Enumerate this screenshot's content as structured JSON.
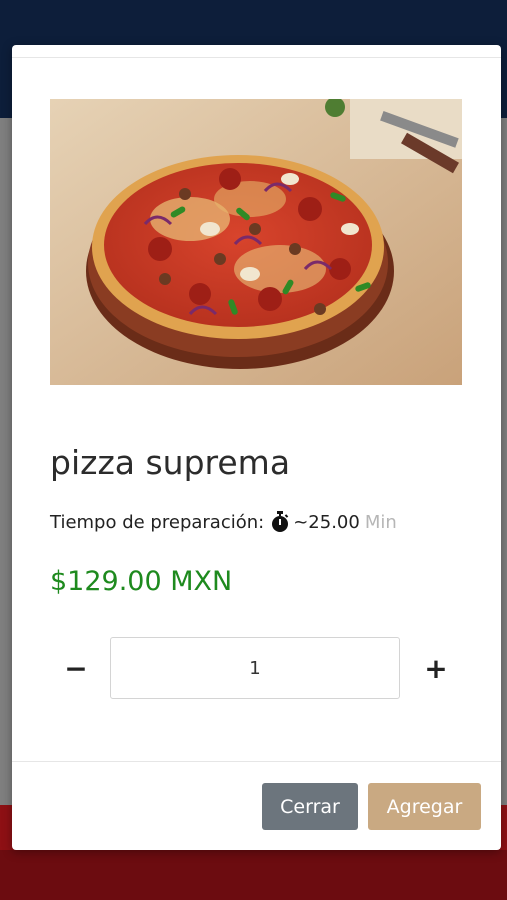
{
  "product": {
    "name": "pizza suprema",
    "prep_label": "Tiempo de preparación:",
    "prep_time": "~25.00",
    "prep_unit": "Min",
    "price": "$129.00 MXN",
    "quantity": "1",
    "image_icon": "pizza-photo"
  },
  "controls": {
    "minus": "−",
    "plus": "+"
  },
  "footer": {
    "close_label": "Cerrar",
    "add_label": "Agregar"
  },
  "colors": {
    "price": "#1e8a1e",
    "close_button": "#6c757d",
    "add_button": "#c9a982",
    "header": "#0d1e3a",
    "footer": "#8e1014"
  }
}
